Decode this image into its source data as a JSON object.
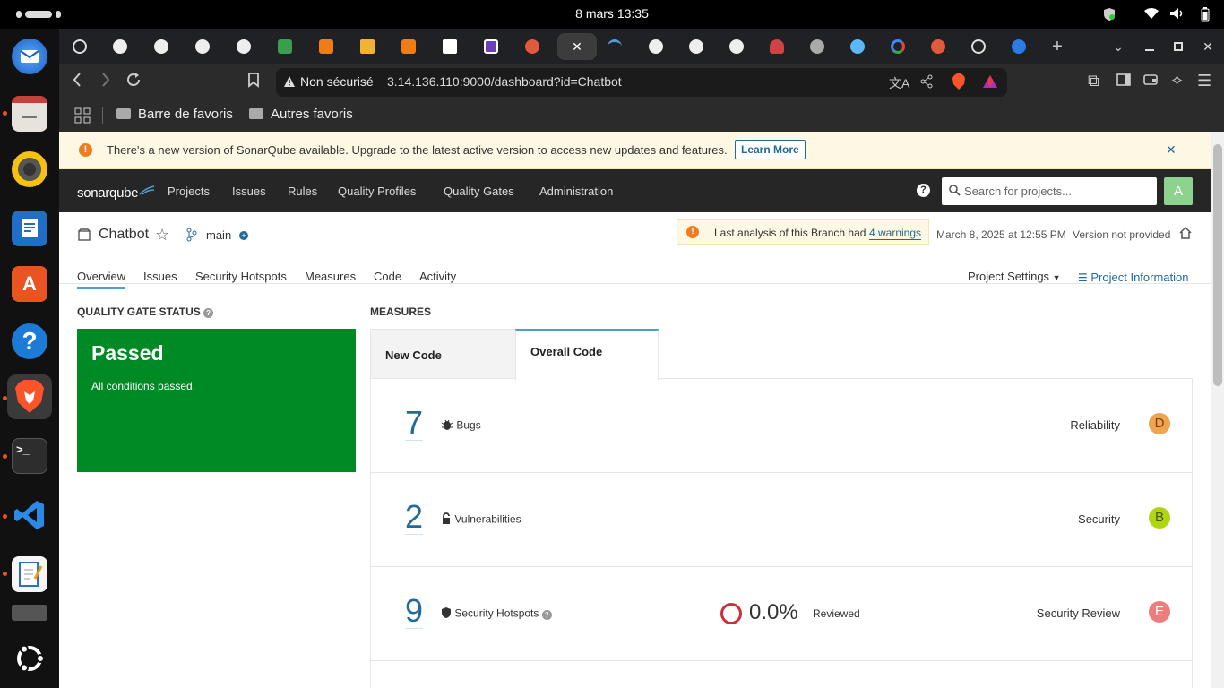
{
  "system": {
    "clock": "8 mars  13:35"
  },
  "browser": {
    "url_security": "Non sécurisé",
    "url": "3.14.136.110:9000/dashboard?id=Chatbot",
    "bookmarks": [
      "Barre de favoris",
      "Autres favoris"
    ]
  },
  "banner": {
    "text": "There's a new version of SonarQube available. Upgrade to the latest active version to access new updates and features.",
    "button": "Learn More"
  },
  "nav": {
    "logo": "sonarqube",
    "items": [
      "Projects",
      "Issues",
      "Rules",
      "Quality Profiles",
      "Quality Gates",
      "Administration"
    ],
    "search_placeholder": "Search for projects...",
    "avatar": "A"
  },
  "project": {
    "name": "Chatbot",
    "branch": "main",
    "warning_prefix": "Last analysis of this Branch had ",
    "warning_link": "4 warnings",
    "date": "March 8, 2025 at 12:55 PM",
    "version": "Version not provided",
    "tabs": [
      "Overview",
      "Issues",
      "Security Hotspots",
      "Measures",
      "Code",
      "Activity"
    ],
    "settings": "Project Settings",
    "info": "Project Information"
  },
  "quality_gate": {
    "title": "QUALITY GATE STATUS",
    "status": "Passed",
    "detail": "All conditions passed."
  },
  "measures": {
    "title": "MEASURES",
    "tabs": [
      "New Code",
      "Overall Code"
    ],
    "rows": [
      {
        "value": "7",
        "label": "Bugs",
        "category": "Reliability",
        "rating": "D"
      },
      {
        "value": "2",
        "label": "Vulnerabilities",
        "category": "Security",
        "rating": "B"
      },
      {
        "value": "9",
        "label": "Security Hotspots",
        "reviewed_pct": "0.0%",
        "reviewed_label": "Reviewed",
        "category": "Security Review",
        "rating": "E"
      }
    ]
  },
  "colors": {
    "passed": "#008a25",
    "rating_D": "#f0a44e",
    "rating_B": "#b0d513",
    "rating_E": "#ed7d7d",
    "accent": "#4b9fd5"
  }
}
